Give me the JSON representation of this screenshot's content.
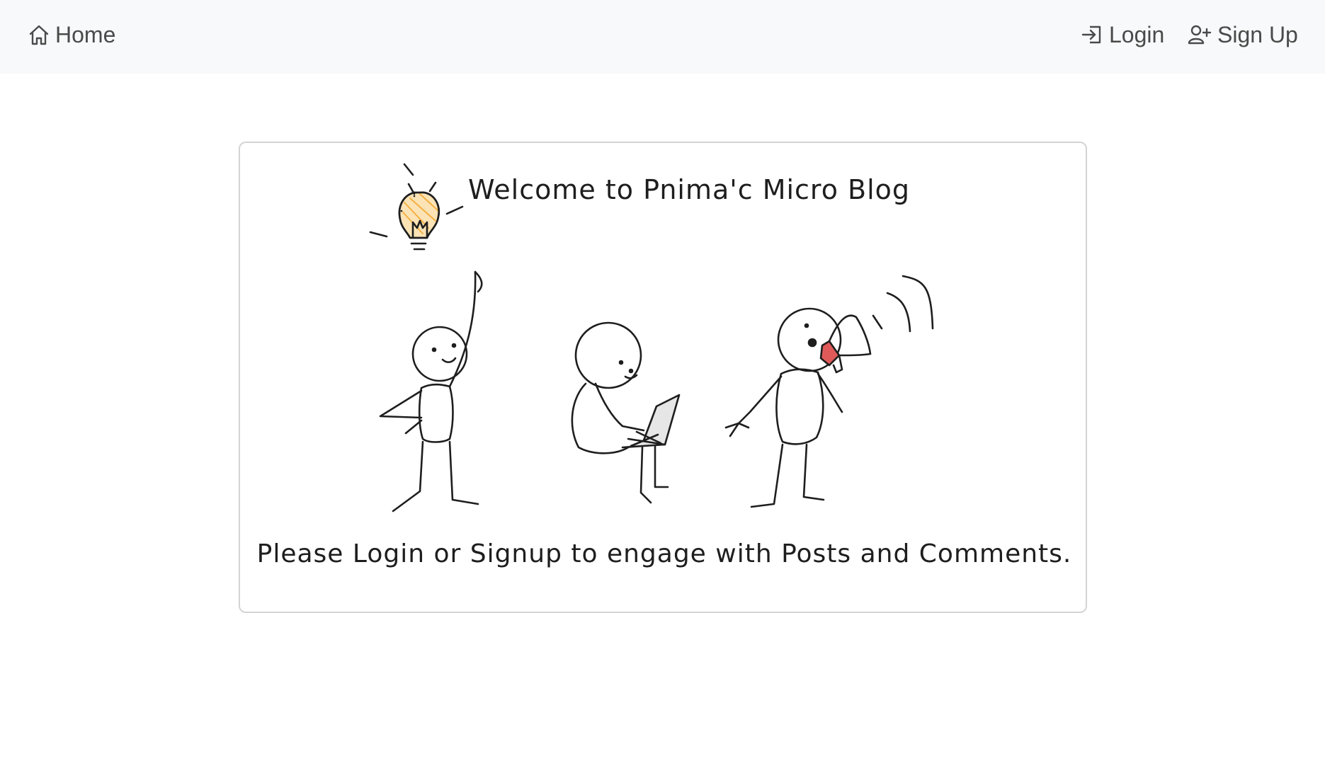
{
  "navbar": {
    "home_label": "Home",
    "login_label": "Login",
    "signup_label": "Sign Up"
  },
  "hero": {
    "title": "Welcome to Pnima'c Micro Blog",
    "message": "Please Login or Signup to engage with Posts and Comments."
  },
  "icons": {
    "home": "house-icon",
    "login": "box-arrow-in-right-icon",
    "signup": "person-plus-icon"
  },
  "colors": {
    "navbar_bg": "#f8f9fa",
    "nav_text": "#4a4a4a",
    "card_border": "#d4d4d4",
    "bulb_fill": "#f5b041",
    "megaphone_red": "#e05a5a"
  }
}
